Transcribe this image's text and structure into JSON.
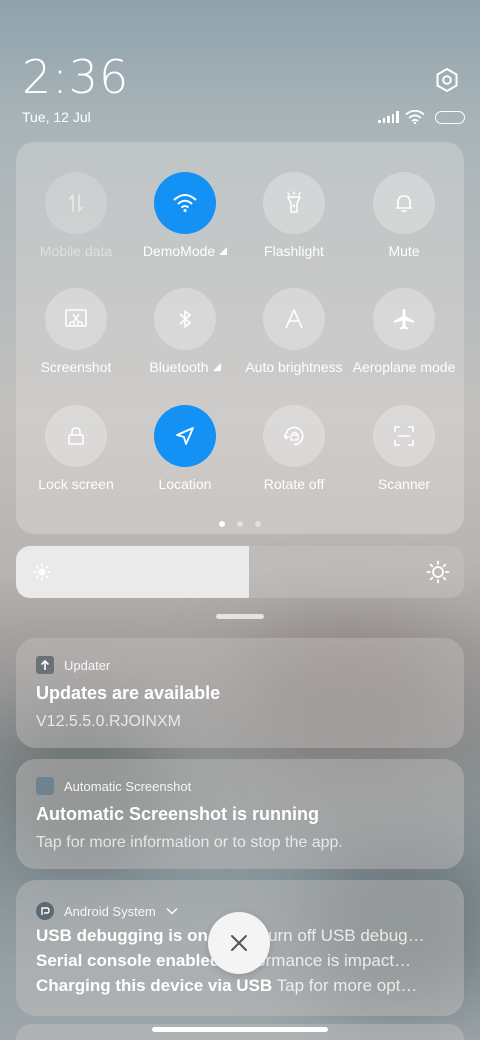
{
  "status_bar": {
    "time": "2:36",
    "date": "Tue, 12 Jul"
  },
  "quick_settings": {
    "tiles": [
      {
        "label": "Mobile data",
        "icon": "mobile-data-icon",
        "state": "disabled"
      },
      {
        "label": "DemoMode",
        "icon": "wifi-icon",
        "state": "on",
        "has_arrow": true
      },
      {
        "label": "Flashlight",
        "icon": "flashlight-icon",
        "state": "off"
      },
      {
        "label": "Mute",
        "icon": "bell-icon",
        "state": "off"
      },
      {
        "label": "Screenshot",
        "icon": "screenshot-icon",
        "state": "off"
      },
      {
        "label": "Bluetooth",
        "icon": "bluetooth-icon",
        "state": "off",
        "has_arrow": true
      },
      {
        "label": "Auto brightness",
        "icon": "auto-brightness-icon",
        "state": "off"
      },
      {
        "label": "Aeroplane mode",
        "icon": "airplane-icon",
        "state": "off"
      },
      {
        "label": "Lock screen",
        "icon": "lock-icon",
        "state": "off"
      },
      {
        "label": "Location",
        "icon": "location-icon",
        "state": "on"
      },
      {
        "label": "Rotate off",
        "icon": "rotate-lock-icon",
        "state": "off"
      },
      {
        "label": "Scanner",
        "icon": "scanner-icon",
        "state": "off"
      }
    ],
    "page_count": 3,
    "active_page": 1,
    "accent_color": "#1491f5"
  },
  "brightness": {
    "level": 0.52
  },
  "notifications": [
    {
      "app": "Updater",
      "title": "Updates are available",
      "body": "V12.5.5.0.RJOINXM"
    },
    {
      "app": "Automatic Screenshot",
      "title": "Automatic Screenshot is running",
      "body": "Tap for more information or to stop the app."
    },
    {
      "app": "Android System",
      "lines": [
        {
          "bold": "USB debugging is on",
          "rest": "Tap to turn off USB debug…"
        },
        {
          "bold": "Serial console enabled",
          "rest": "Performance is impact…"
        },
        {
          "bold": "Charging this device via USB",
          "rest": "Tap for more opt…"
        }
      ]
    }
  ]
}
